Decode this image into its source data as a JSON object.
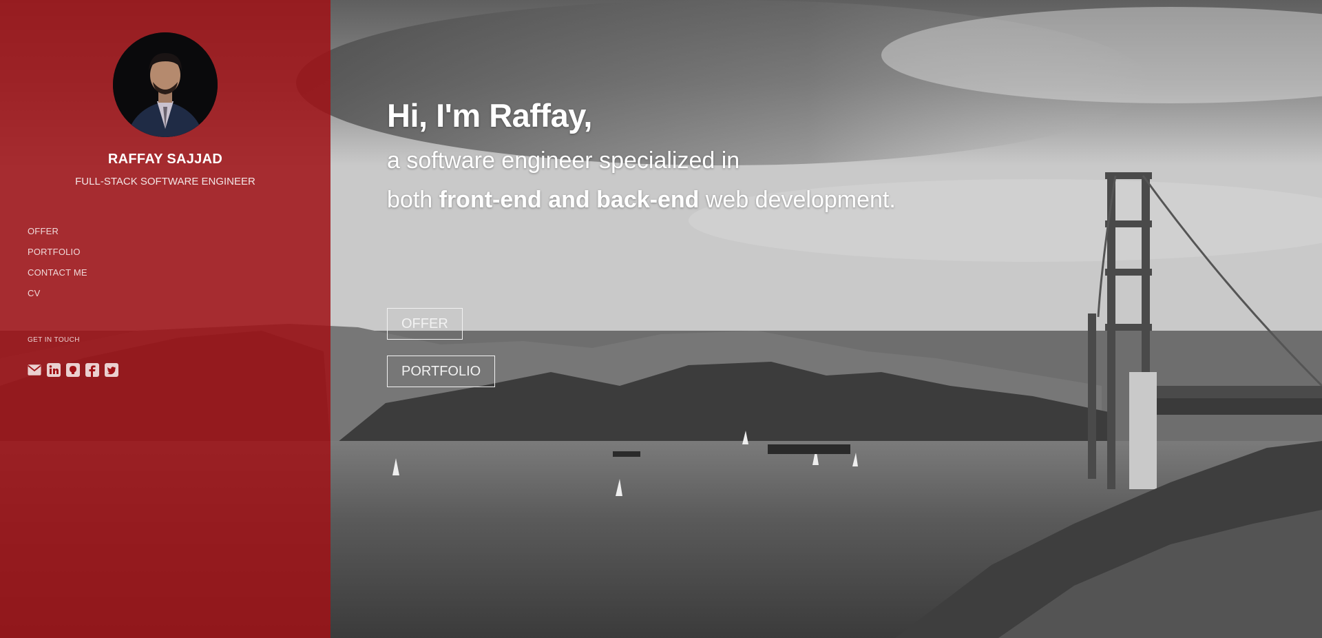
{
  "profile": {
    "name": "RAFFAY SAJJAD",
    "role": "FULL-STACK SOFTWARE ENGINEER"
  },
  "nav": {
    "items": [
      {
        "label": "OFFER"
      },
      {
        "label": "PORTFOLIO"
      },
      {
        "label": "CONTACT ME"
      },
      {
        "label": "CV"
      }
    ]
  },
  "contact": {
    "title": "GET IN TOUCH",
    "icons": [
      "envelope-icon",
      "linkedin-icon",
      "github-icon",
      "facebook-icon",
      "twitter-icon"
    ]
  },
  "hero": {
    "greeting": "Hi, I'm Raffay,",
    "line1": "a software engineer specialized in",
    "line2_before": "both ",
    "line2_bold": "front-end and back-end",
    "line2_after": " web development.",
    "buttons": {
      "offer": "OFFER",
      "portfolio": "PORTFOLIO"
    }
  },
  "colors": {
    "sidebar_overlay": "#a01216",
    "text": "#ffffff"
  }
}
